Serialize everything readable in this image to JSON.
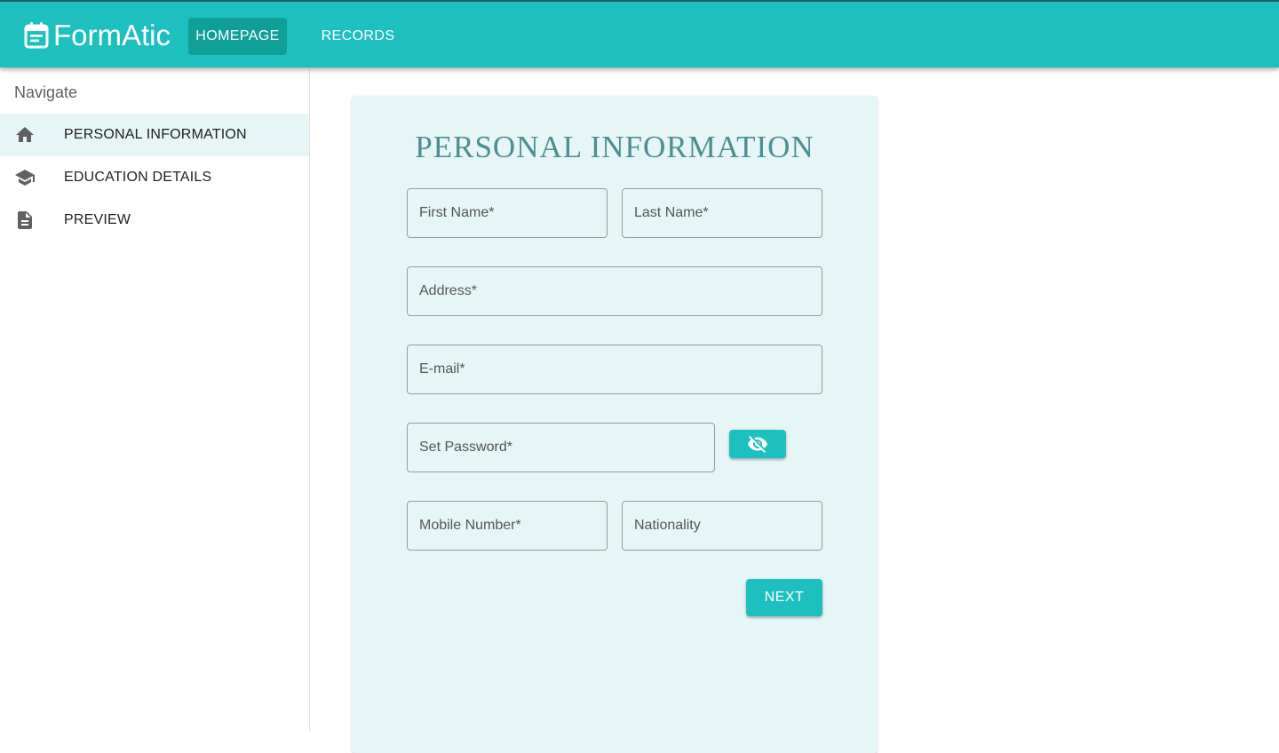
{
  "app": {
    "brand": "FormAtic",
    "brand_icon": "calendar-form-icon",
    "accent_color": "#1dbfbf",
    "accent_dark": "#109f96"
  },
  "header": {
    "nav": [
      {
        "label": "HOMEPAGE",
        "active": true
      },
      {
        "label": "RECORDS",
        "active": false
      }
    ]
  },
  "sidebar": {
    "title": "Navigate",
    "items": [
      {
        "label": "PERSONAL INFORMATION",
        "icon": "home-icon",
        "active": true
      },
      {
        "label": "EDUCATION DETAILS",
        "icon": "school-icon",
        "active": false
      },
      {
        "label": "PREVIEW",
        "icon": "document-icon",
        "active": false
      }
    ]
  },
  "form": {
    "title": "PERSONAL INFORMATION",
    "fields": {
      "first_name": {
        "placeholder": "First Name*",
        "value": ""
      },
      "last_name": {
        "placeholder": "Last Name*",
        "value": ""
      },
      "address": {
        "placeholder": "Address*",
        "value": ""
      },
      "email": {
        "placeholder": "E-mail*",
        "value": ""
      },
      "password": {
        "placeholder": "Set Password*",
        "value": ""
      },
      "mobile": {
        "placeholder": "Mobile Number*",
        "value": ""
      },
      "nationality": {
        "placeholder": "Nationality",
        "value": ""
      }
    },
    "password_toggle_icon": "visibility-off-icon",
    "next_label": "NEXT"
  }
}
